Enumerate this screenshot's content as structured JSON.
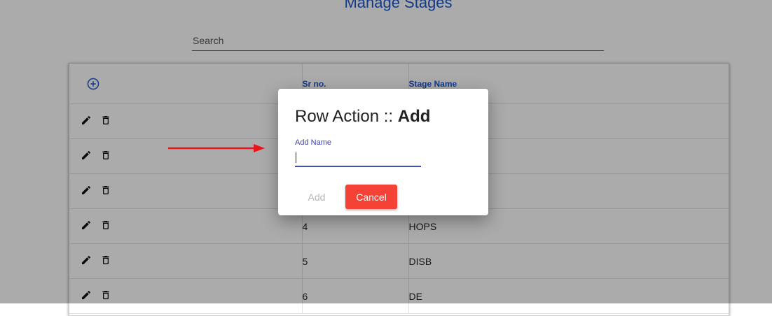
{
  "page": {
    "title": "Manage Stages"
  },
  "search": {
    "placeholder": "Search",
    "value": ""
  },
  "table": {
    "columns": [
      "",
      "Sr no.",
      "Stage Name"
    ],
    "rows": [
      {
        "sr": "",
        "name": ""
      },
      {
        "sr": "",
        "name": ""
      },
      {
        "sr": "",
        "name": ""
      },
      {
        "sr": "4",
        "name": "HOPS"
      },
      {
        "sr": "5",
        "name": "DISB"
      },
      {
        "sr": "6",
        "name": "DE"
      }
    ]
  },
  "dialog": {
    "title_prefix": "Row Action :: ",
    "title_action": "Add",
    "field_label": "Add Name",
    "field_value": "",
    "add_label": "Add",
    "cancel_label": "Cancel"
  },
  "icons": {
    "add": "add-circle-icon",
    "edit": "pencil-icon",
    "delete": "trash-icon",
    "annotation": "red-arrow-icon"
  },
  "colors": {
    "accent": "#1e55c9",
    "cancel": "#f44336",
    "arrow": "#e8151b",
    "input_underline": "#3f51b5"
  }
}
